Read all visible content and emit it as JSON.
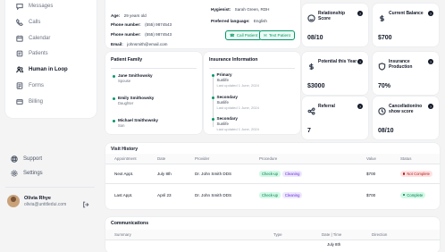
{
  "sidebar": {
    "items": [
      {
        "label": "Messages",
        "icon": "message-icon"
      },
      {
        "label": "Calls",
        "icon": "phone-icon"
      },
      {
        "label": "Calendar",
        "icon": "calendar-icon"
      },
      {
        "label": "Patients",
        "icon": "patients-icon"
      },
      {
        "label": "Human in Loop",
        "icon": "human-loop-icon",
        "active": true
      },
      {
        "label": "Forms",
        "icon": "forms-icon"
      },
      {
        "label": "Billing",
        "icon": "billing-icon"
      }
    ],
    "support": "Support",
    "settings": "Settings",
    "user": {
      "name": "Olivia Rhye",
      "email": "olivia@untitledui.com"
    }
  },
  "patient": {
    "age_label": "Age:",
    "age": "29 years old",
    "phone_label": "Phone number:",
    "phone": "(555) 9874543",
    "phone2_label": "Phone number:",
    "phone2": "(555) 9874543",
    "email_label": "Email:",
    "email": "johnsmith@email.com",
    "hygienist_label": "Hygienist:",
    "hygienist": "Sarah Green, RDH",
    "language_label": "Preferred language:",
    "language": "English",
    "call_btn": "Call Patient",
    "text_btn": "Text Patient"
  },
  "family": {
    "title": "Patient Family",
    "members": [
      {
        "name": "Jane Smithowsky",
        "relation": "Spouse"
      },
      {
        "name": "Emily Smithowsky",
        "relation": "Daughter"
      },
      {
        "name": "Michael Smithowsky",
        "relation": "Son"
      }
    ]
  },
  "insurance": {
    "title": "Insurance Information",
    "entries": [
      {
        "type": "Primary",
        "name": "Sunlife",
        "updated": "Last updated 1 June, 2024"
      },
      {
        "type": "Secondary",
        "name": "Sunlife",
        "updated": "Last updated 1 June, 2024"
      },
      {
        "type": "Secondary",
        "name": "Sunlife",
        "updated": "Last updated 1 June, 2024"
      }
    ]
  },
  "stats": [
    {
      "label": "Relationship Score",
      "value": "08/10",
      "icon": "smile-icon"
    },
    {
      "label": "Current Balance",
      "value": "$700",
      "icon": "dollar-icon"
    },
    {
      "label": "Potential this Year",
      "value": "$3000",
      "icon": "dollar-icon"
    },
    {
      "label": "Insurance Production",
      "value": "70%",
      "icon": "shield-icon"
    },
    {
      "label": "Referral",
      "value": "7",
      "icon": "share-icon"
    },
    {
      "label": "Cancellation/no show score",
      "value": "08/10",
      "icon": "clock-icon"
    }
  ],
  "visit_history": {
    "title": "Visit History",
    "columns": [
      "Appointment",
      "Date",
      "Provider",
      "Procedure",
      "Value",
      "Status"
    ],
    "rows": [
      {
        "appointment": "Next Appt.",
        "date": "July 8th",
        "provider": "Dr. John Smith DDS",
        "tags": [
          "Check-up",
          "Cleaning"
        ],
        "value": "$700",
        "status": "Not Complete",
        "status_color": "red"
      },
      {
        "appointment": "Last Appt.",
        "date": "April 23",
        "provider": "Dr. John Smith DDS",
        "tags": [
          "Check-up",
          "Cleaning"
        ],
        "value": "$700",
        "status": "Complete",
        "status_color": "green"
      }
    ]
  },
  "communications": {
    "title": "Communications",
    "columns": [
      "Summary",
      "Type",
      "Date | Time",
      "Direction"
    ],
    "first_date": "July 8th"
  }
}
